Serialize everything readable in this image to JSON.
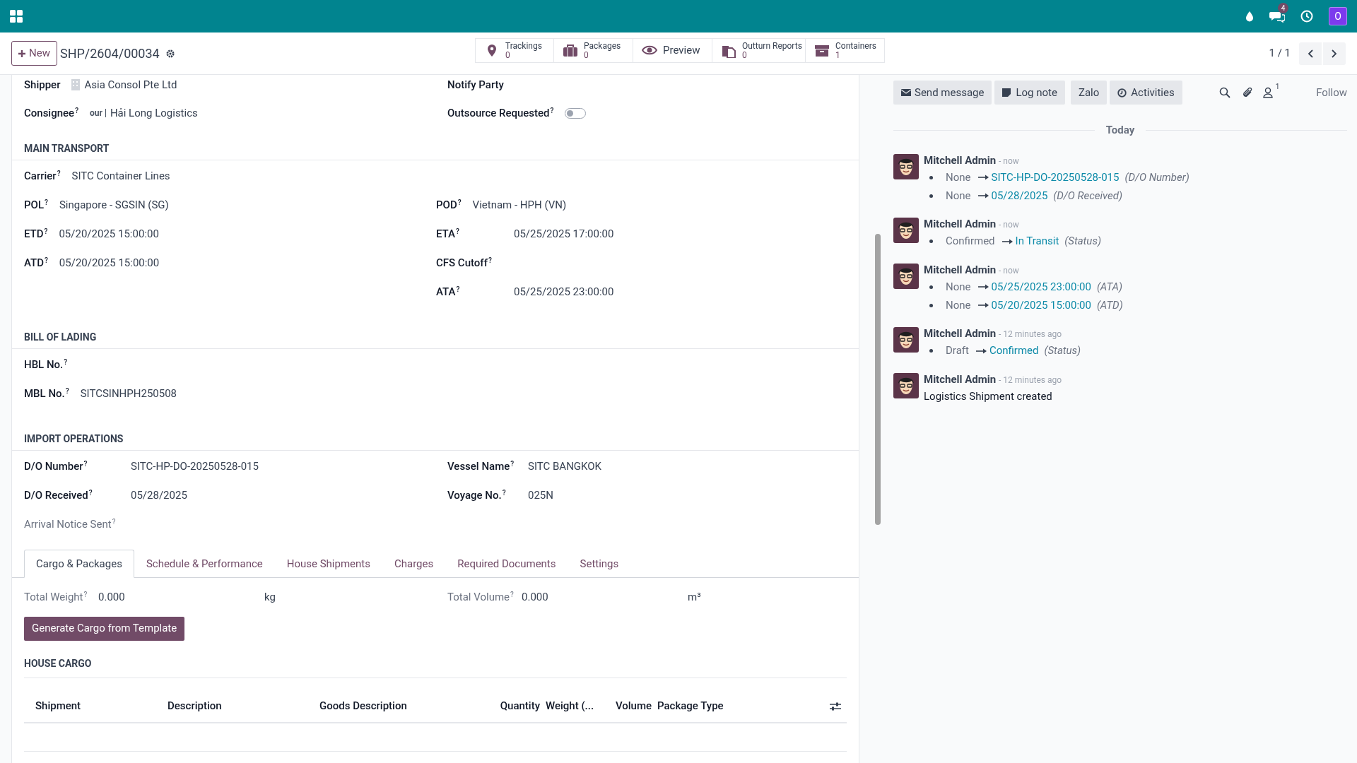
{
  "topbar": {
    "messages_badge": "4",
    "user_initial": "O"
  },
  "control_panel": {
    "new_label": "New",
    "record_name": "SHP/2604/00034",
    "stat_buttons": [
      {
        "kind": "pin",
        "label": "Trackings",
        "count": "0"
      },
      {
        "kind": "box",
        "label": "Packages",
        "count": "0"
      },
      {
        "kind": "eye",
        "label": "Preview"
      },
      {
        "kind": "docs",
        "label": "Outturn Reports",
        "count": "0"
      },
      {
        "kind": "archive",
        "label": "Containers",
        "count": "1"
      }
    ],
    "pager": "1 / 1"
  },
  "header_fields": [
    [
      {
        "kind": "partner",
        "label": "Shipper",
        "value": "Asia Consol Pte Ltd"
      },
      {
        "kind": "plain",
        "label": "Notify Party"
      }
    ],
    [
      {
        "kind": "partner_logo",
        "label": "Consignee",
        "help": "?",
        "logo": "our",
        "value": "Hải Long Logistics"
      },
      {
        "kind": "toggle",
        "label": "Outsource Requested",
        "help": "?",
        "on": false
      }
    ]
  ],
  "sections": [
    {
      "title": "MAIN TRANSPORT",
      "rows": [
        [
          {
            "kind": "plain",
            "label": "Carrier",
            "help": "?",
            "value": "SITC Container Lines"
          }
        ],
        [
          {
            "kind": "plain",
            "label": "POL",
            "help": "?",
            "value": "Singapore - SGSIN (SG)"
          },
          {
            "kind": "plain",
            "label": "POD",
            "help": "?",
            "value": "Vietnam - HPH (VN)"
          }
        ],
        [
          {
            "kind": "plain",
            "label": "ETD",
            "help": "?",
            "value": "05/20/2025 15:00:00"
          },
          {
            "kind": "wide",
            "label": "ETA",
            "help": "?",
            "value": "05/25/2025 17:00:00"
          }
        ],
        [
          {
            "kind": "plain",
            "label": "ATD",
            "help": "?",
            "value": "05/20/2025 15:00:00"
          },
          {
            "kind": "wide",
            "label": "CFS Cutoff",
            "help": "?"
          }
        ],
        [
          null,
          {
            "kind": "wide",
            "label": "ATA",
            "help": "?",
            "value": "05/25/2025 23:00:00"
          }
        ]
      ]
    },
    {
      "title": "BILL OF LADING",
      "rows": [
        [
          {
            "kind": "plain",
            "label": "HBL No.",
            "help": "?"
          }
        ],
        [
          {
            "kind": "plain",
            "label": "MBL No.",
            "help": "?",
            "value": "SITCSINHPH250508"
          }
        ]
      ]
    },
    {
      "title": "IMPORT OPERATIONS",
      "rows": [
        [
          {
            "kind": "wide",
            "label": "D/O Number",
            "help": "?",
            "value": "SITC-HP-DO-20250528-015"
          },
          {
            "kind": "wide",
            "label": "Vessel Name",
            "help": "?",
            "value": "SITC BANGKOK"
          }
        ],
        [
          {
            "kind": "wide",
            "label": "D/O Received",
            "help": "?",
            "value": "05/28/2025"
          },
          {
            "kind": "wide",
            "label": "Voyage No.",
            "help": "?",
            "value": "025N"
          }
        ],
        [
          {
            "kind": "muted",
            "label": "Arrival Notice Sent",
            "help": "?"
          }
        ]
      ]
    }
  ],
  "tabs": [
    {
      "label": "Cargo & Packages",
      "selected": true
    },
    {
      "label": "Schedule & Performance",
      "selected": false
    },
    {
      "label": "House Shipments",
      "selected": false
    },
    {
      "label": "Charges",
      "selected": false
    },
    {
      "label": "Required Documents",
      "selected": false
    },
    {
      "label": "Settings",
      "selected": false
    }
  ],
  "totals": [
    {
      "label": "Total Weight",
      "help": "?",
      "value": "0.000",
      "unit": "kg"
    },
    {
      "label": "Total Volume",
      "help": "?",
      "value": "0.000",
      "unit": "m³"
    }
  ],
  "generate_button": "Generate Cargo from Template",
  "house_cargo": {
    "title": "HOUSE CARGO",
    "columns": [
      "Shipment",
      "Description",
      "Goods Description",
      "Quantity",
      "Weight (...",
      "Volume",
      "Package Type"
    ]
  },
  "chatter": {
    "buttons": [
      {
        "kind": "envelope",
        "label": "Send message"
      },
      {
        "kind": "note",
        "label": "Log note"
      },
      {
        "kind": "none",
        "label": "Zalo"
      },
      {
        "kind": "clock",
        "label": "Activities"
      }
    ],
    "followers_count": "1",
    "follow_label": "Follow",
    "date_separator": "Today",
    "messages": [
      {
        "author": "Mitchell Admin",
        "time": "- now",
        "changes": [
          {
            "old": "None",
            "new": "SITC-HP-DO-20250528-015",
            "field": "(D/O Number)"
          },
          {
            "old": "None",
            "new": "05/28/2025",
            "field": "(D/O Received)"
          }
        ]
      },
      {
        "author": "Mitchell Admin",
        "time": "- now",
        "changes": [
          {
            "old": "Confirmed",
            "new": "In Transit",
            "field": "(Status)"
          }
        ]
      },
      {
        "author": "Mitchell Admin",
        "time": "- now",
        "changes": [
          {
            "old": "None",
            "new": "05/25/2025 23:00:00",
            "field": "(ATA)"
          },
          {
            "old": "None",
            "new": "05/20/2025 15:00:00",
            "field": "(ATD)"
          }
        ]
      },
      {
        "author": "Mitchell Admin",
        "time": "- 12 minutes ago",
        "changes": [
          {
            "old": "Draft",
            "new": "Confirmed",
            "field": "(Status)"
          }
        ]
      },
      {
        "author": "Mitchell Admin",
        "time": "- 12 minutes ago",
        "body": "Logistics Shipment created"
      }
    ]
  }
}
